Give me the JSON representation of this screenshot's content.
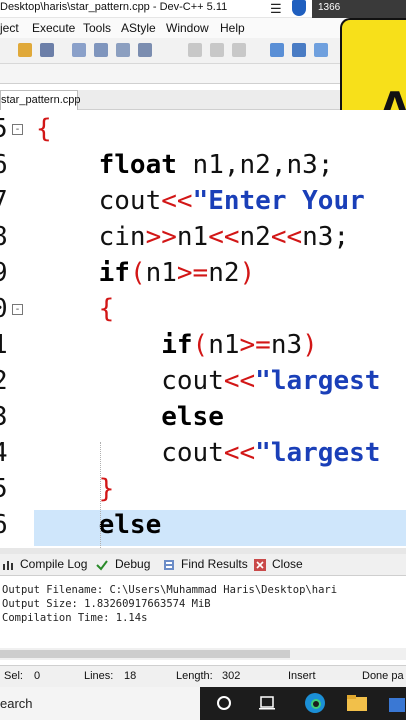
{
  "window": {
    "title": "Desktop\\haris\\star_pattern.cpp - Dev-C++ 5.11",
    "resolution_text": "1366"
  },
  "menu": [
    "ject",
    "Execute",
    "Tools",
    "AStyle",
    "Window",
    "Help"
  ],
  "editor_tab": "star_pattern.cpp",
  "overlay_letter": "A",
  "code_lines": [
    {
      "num": "5",
      "fold": "⊟",
      "parts": [
        {
          "t": "{",
          "c": "brace"
        }
      ]
    },
    {
      "num": "6",
      "parts": [
        {
          "t": "    "
        },
        {
          "t": "float",
          "c": "kw"
        },
        {
          "t": " n1,n2,n3;",
          "c": "plain"
        }
      ]
    },
    {
      "num": "7",
      "parts": [
        {
          "t": "    "
        },
        {
          "t": "cout",
          "c": "plain"
        },
        {
          "t": "<<",
          "c": "op"
        },
        {
          "t": "\"Enter Your",
          "c": "str"
        }
      ]
    },
    {
      "num": "8",
      "parts": [
        {
          "t": "    "
        },
        {
          "t": "cin",
          "c": "plain"
        },
        {
          "t": ">>",
          "c": "op"
        },
        {
          "t": "n1",
          "c": "plain"
        },
        {
          "t": "<<",
          "c": "op"
        },
        {
          "t": "n2",
          "c": "plain"
        },
        {
          "t": "<<",
          "c": "op"
        },
        {
          "t": "n3;",
          "c": "plain"
        }
      ]
    },
    {
      "num": "9",
      "parts": [
        {
          "t": "    "
        },
        {
          "t": "if",
          "c": "kw"
        },
        {
          "t": "(",
          "c": "op"
        },
        {
          "t": "n1",
          "c": "plain"
        },
        {
          "t": ">=",
          "c": "op"
        },
        {
          "t": "n2",
          "c": "plain"
        },
        {
          "t": ")",
          "c": "op"
        }
      ]
    },
    {
      "num": "0",
      "fold": "⊟",
      "parts": [
        {
          "t": "    "
        },
        {
          "t": "{",
          "c": "brace"
        }
      ]
    },
    {
      "num": "1",
      "parts": [
        {
          "t": "        "
        },
        {
          "t": "if",
          "c": "kw"
        },
        {
          "t": "(",
          "c": "op"
        },
        {
          "t": "n1",
          "c": "plain"
        },
        {
          "t": ">=",
          "c": "op"
        },
        {
          "t": "n3",
          "c": "plain"
        },
        {
          "t": ")",
          "c": "op"
        }
      ]
    },
    {
      "num": "2",
      "parts": [
        {
          "t": "        "
        },
        {
          "t": "cout",
          "c": "plain"
        },
        {
          "t": "<<",
          "c": "op"
        },
        {
          "t": "\"largest",
          "c": "str"
        }
      ]
    },
    {
      "num": "3",
      "parts": [
        {
          "t": "        "
        },
        {
          "t": "else",
          "c": "kw"
        }
      ]
    },
    {
      "num": "4",
      "parts": [
        {
          "t": "        "
        },
        {
          "t": "cout",
          "c": "plain"
        },
        {
          "t": "<<",
          "c": "op"
        },
        {
          "t": "\"largest",
          "c": "str"
        }
      ]
    },
    {
      "num": "5",
      "parts": [
        {
          "t": "    "
        },
        {
          "t": "}",
          "c": "brace"
        }
      ]
    },
    {
      "num": "6",
      "parts": [
        {
          "t": "    "
        },
        {
          "t": "else",
          "c": "kw"
        }
      ],
      "current": true
    }
  ],
  "bottom_tabs": {
    "compile_log": "Compile Log",
    "debug": "Debug",
    "find_results": "Find Results",
    "close": "Close"
  },
  "compile_output": {
    "filename": "Output Filename: C:\\Users\\Muhammad Haris\\Desktop\\hari",
    "size": "Output Size: 1.83260917663574 MiB",
    "time": "Compilation Time: 1.14s"
  },
  "status": {
    "sel": "Sel:",
    "sel_val": "0",
    "lines": "Lines:",
    "lines_val": "18",
    "length": "Length:",
    "length_val": "302",
    "mode": "Insert",
    "parse": "Done pa"
  },
  "taskbar": {
    "search": "earch"
  },
  "colors": {
    "keyword": "#000000",
    "operator": "#d21616",
    "string": "#1a3fb8",
    "current_line": "#cfe6fb",
    "overlay": "#f7e01a"
  }
}
